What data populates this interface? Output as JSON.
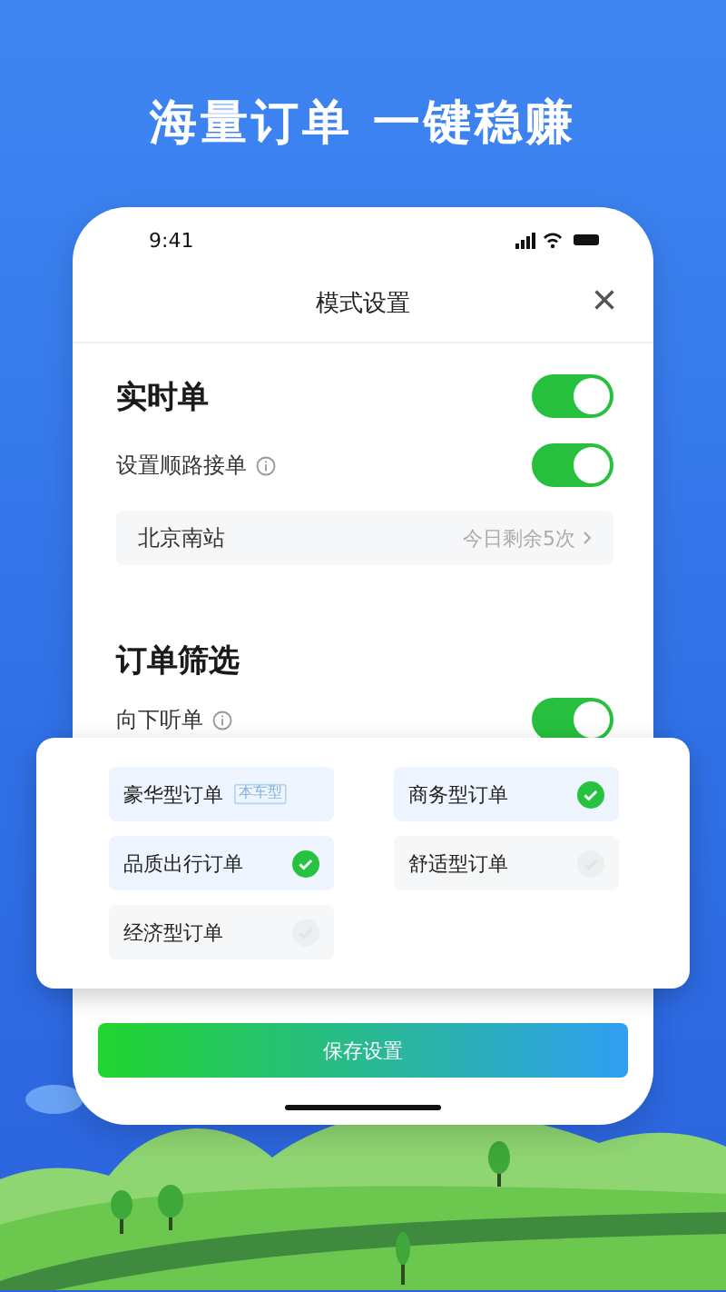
{
  "headline": "海量订单 一键稳赚",
  "status_bar": {
    "time": "9:41"
  },
  "header": {
    "title": "模式设置",
    "close": "×"
  },
  "realtime": {
    "title": "实时单",
    "on": true
  },
  "route_order": {
    "label": "设置顺路接单",
    "on": true
  },
  "station": {
    "name": "北京南站",
    "remaining": "今日剩余5次"
  },
  "filter": {
    "title": "订单筛选",
    "downward": {
      "label": "向下听单",
      "on": true
    }
  },
  "order_types": [
    {
      "label": "豪华型订单",
      "selected": true,
      "tag": "本车型"
    },
    {
      "label": "商务型订单",
      "selected": true
    },
    {
      "label": "品质出行订单",
      "selected": true
    },
    {
      "label": "舒适型订单",
      "selected": false
    },
    {
      "label": "经济型订单",
      "selected": false
    }
  ],
  "save_button": "保存设置"
}
